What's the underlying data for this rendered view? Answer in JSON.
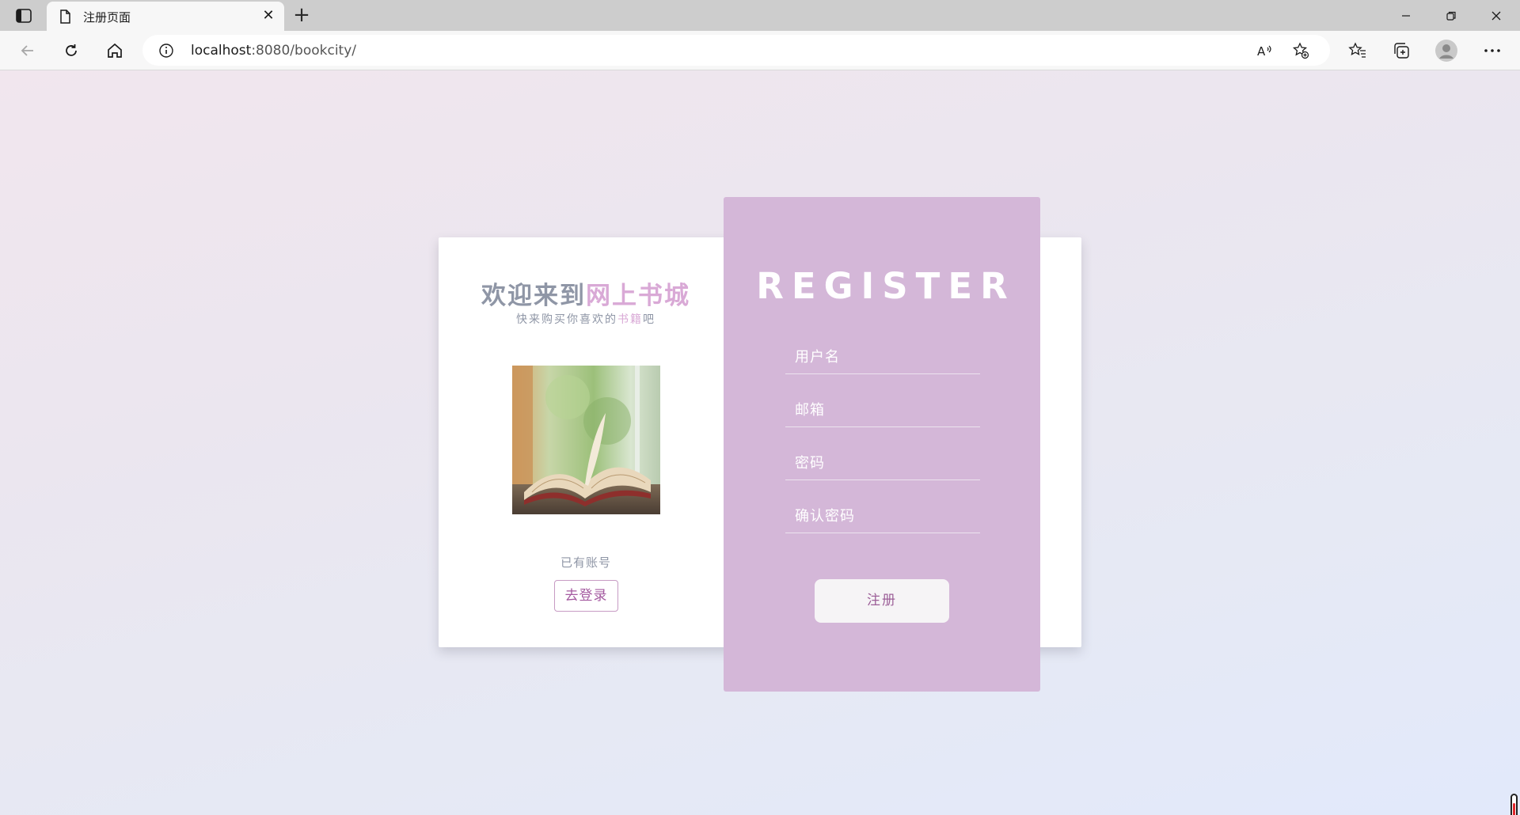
{
  "browser": {
    "tab_title": "注册页面",
    "url_host": "localhost",
    "url_rest": ":8080/bookcity/"
  },
  "welcome": {
    "title_part1": "欢迎来到",
    "title_part2": "网上书城",
    "subtitle_part1": "快来购买你喜欢的",
    "subtitle_highlight": "书籍",
    "subtitle_part2": "吧",
    "have_account": "已有账号",
    "login_button": "去登录"
  },
  "register": {
    "title": "REGISTER",
    "fields": [
      {
        "placeholder": "用户名"
      },
      {
        "placeholder": "邮箱"
      },
      {
        "placeholder": "密码"
      },
      {
        "placeholder": "确认密码"
      }
    ],
    "submit": "注册"
  },
  "colors": {
    "accent": "#d4b7d8",
    "highlight_text": "#d9a9d6",
    "muted_text": "#8f96a6",
    "button_text": "#9c5f98"
  },
  "icons": [
    "sidebar-toggle-icon",
    "page-icon",
    "close-icon",
    "plus-icon",
    "minimize-icon",
    "restore-icon",
    "back-arrow-icon",
    "refresh-icon",
    "home-icon",
    "info-icon",
    "read-aloud-icon",
    "add-favorite-icon",
    "favorites-icon",
    "collections-icon",
    "profile-icon",
    "more-icon"
  ]
}
